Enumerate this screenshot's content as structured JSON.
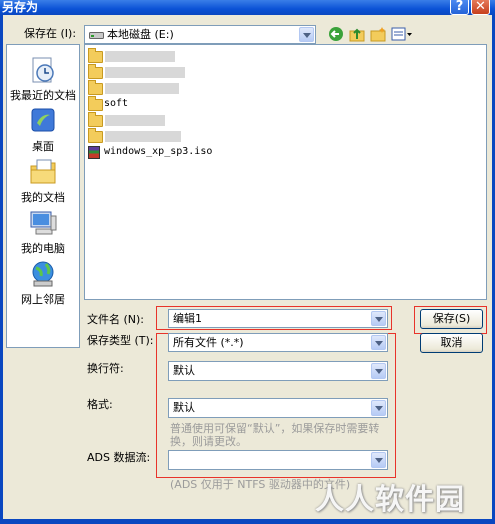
{
  "window": {
    "title": "另存为",
    "help_glyph": "?",
    "close_glyph": "✕"
  },
  "toolbar": {
    "save_in_label": "保存在 (I):",
    "location": "本地磁盘 (E:)",
    "icons": [
      "back-icon",
      "up-folder-icon",
      "new-folder-icon",
      "view-menu-icon"
    ]
  },
  "places": [
    {
      "label": "我最近的文档",
      "icon": "recent-documents-icon"
    },
    {
      "label": "桌面",
      "icon": "desktop-icon"
    },
    {
      "label": "我的文档",
      "icon": "my-documents-icon"
    },
    {
      "label": "我的电脑",
      "icon": "my-computer-icon"
    },
    {
      "label": "网上邻居",
      "icon": "network-places-icon"
    }
  ],
  "files": [
    {
      "name": "",
      "type": "folder",
      "blurred": true
    },
    {
      "name": "",
      "type": "folder",
      "blurred": true
    },
    {
      "name": "",
      "type": "folder",
      "blurred": true
    },
    {
      "name": "soft",
      "type": "folder",
      "blurred": false
    },
    {
      "name": "",
      "type": "folder",
      "blurred": true
    },
    {
      "name": "",
      "type": "folder",
      "blurred": true
    },
    {
      "name": "windows_xp_sp3.iso",
      "type": "rar",
      "blurred": false
    }
  ],
  "form": {
    "filename_label": "文件名 (N):",
    "filename_value": "编辑1",
    "savetype_label": "保存类型 (T):",
    "savetype_value": "所有文件 (*.*)",
    "newline_label": "换行符:",
    "newline_value": "默认",
    "format_label": "格式:",
    "format_value": "默认",
    "format_hint": "普通使用可保留“默认”，如果保存时需要转换，则请更改。",
    "ads_label": "ADS 数据流:",
    "ads_value": "",
    "ads_hint": "(ADS 仅用于 NTFS 驱动器中的文件)"
  },
  "buttons": {
    "save": "保存(S)",
    "cancel": "取消"
  },
  "watermark": "人人软件园",
  "colors": {
    "title_bar": "#0a47c0",
    "dialog_bg": "#ECE9D8",
    "highlight_box": "#e8332a",
    "input_border": "#7f9db9"
  }
}
